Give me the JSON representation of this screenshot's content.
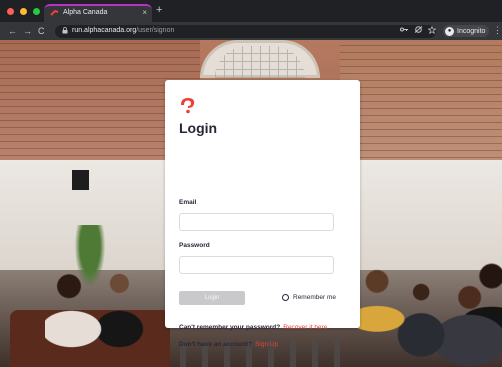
{
  "browser": {
    "tab_title": "Alpha Canada",
    "tab_close": "×",
    "new_tab": "+",
    "nav_back": "←",
    "nav_forward": "→",
    "nav_reload": "C",
    "url_host": "run.alphacanada.org",
    "url_path": "/user/signon",
    "incognito_label": "Incognito",
    "menu": "⋮"
  },
  "login": {
    "title": "Login",
    "email_label": "Email",
    "email_value": "",
    "password_label": "Password",
    "password_value": "",
    "login_button": "Login",
    "remember_label": "Remember me",
    "forgot_question": "Can't remember your password?",
    "forgot_link": "Recover it here",
    "signup_question": "Don't have an account?",
    "signup_link": "Sign Up"
  },
  "colors": {
    "accent": "#e8413c",
    "tab_indicator": "#b733c8"
  }
}
